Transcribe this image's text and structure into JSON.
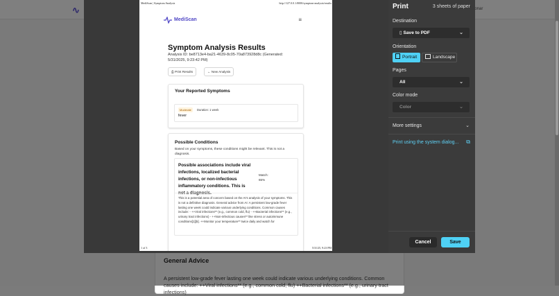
{
  "background": {
    "header_right": "ionar",
    "general_advice_title": "General Advice",
    "general_advice_text": "A persistent low-grade fever lasting one week could indicate various underlying conditions. Common causes include: ++Viral infections** (e.g., common cold, flu) ++Bacterial infections** (e.g., urinary tract infections)"
  },
  "preview": {
    "header_title": "MediScan | Symptom Analysis",
    "header_url": "http://127.0.0.1:8000/symptom-analysis/results",
    "footer_page": "1 of 3",
    "footer_date": "5/31/25, 9:23 PM",
    "logo_text": "MediScan",
    "page_title": "Symptom Analysis Results",
    "analysis_id": "Analysis ID: be8713e4-ba21-4639-8c05-70a873928d8c (Generated: 5/31/2025, 9:23:42 PM)",
    "print_button": "Print Results",
    "new_analysis_button": "New Analysis",
    "symptoms_title": "Your Reported Symptoms",
    "severity_badge": "Moderate",
    "duration": "Duration: 1 week",
    "symptom_name": "fever",
    "conditions_title": "Possible Conditions",
    "conditions_intro": "Based on your symptoms, these conditions might be relevant. This is not a diagnosis.",
    "condition_title": "Possible associations include viral infections, localized bacterial infections, or non-infectious inflammatory conditions. This is not a diagnosis.",
    "match_label": "Match:",
    "match_value": "65%",
    "condition_desc": "This is a potential area of concern based on the AI's analysis of your symptoms. This is not a definitive diagnosis. General advice from AI: A persistent low-grade fever lasting one week could indicate various underlying conditions. Common causes include: - ++Viral infections** (e.g., common cold, flu) - ++Bacterial infections** (e.g., urinary tract infections) - ++Non-infectious causes** like stress or autoimmune conditions[1][5]. ++Monitor your temperature** twice daily and watch for"
  },
  "panel": {
    "title": "Print",
    "sheets": "3 sheets of paper",
    "destination_label": "Destination",
    "destination_value": "Save to PDF",
    "orientation_label": "Orientation",
    "portrait": "Portrait",
    "landscape": "Landscape",
    "pages_label": "Pages",
    "pages_value": "All",
    "color_label": "Color mode",
    "color_value": "Color",
    "more_settings": "More settings",
    "system_dialog": "Print using the system dialog...",
    "cancel": "Cancel",
    "save": "Save"
  }
}
